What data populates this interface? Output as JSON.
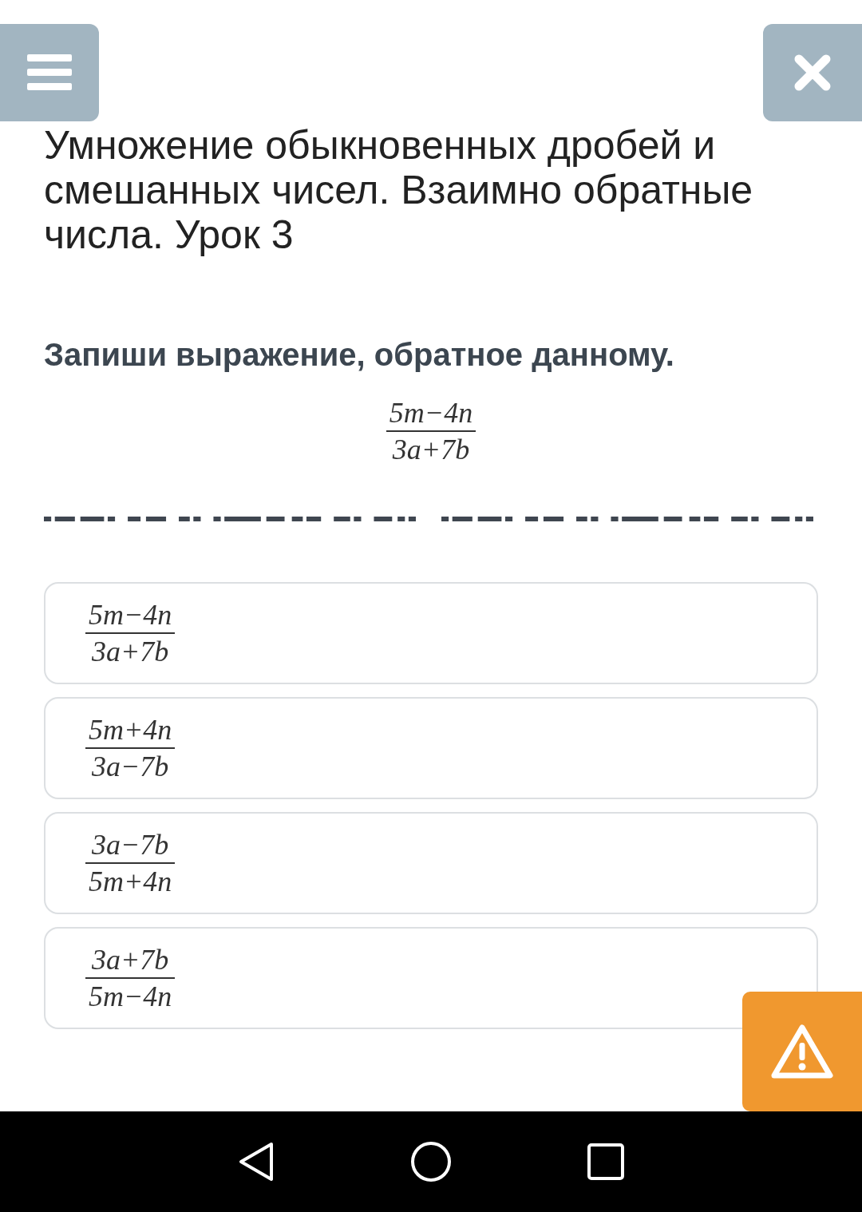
{
  "title": "Умножение обыкновенных дробей и смешанных чисел. Взаимно обратные числа. Урок 3",
  "question": "Запиши выражение, обратное данному.",
  "expression": {
    "numerator": "5m−4n",
    "denominator": "3a+7b"
  },
  "options": [
    {
      "numerator": "5m−4n",
      "denominator": "3a+7b"
    },
    {
      "numerator": "5m+4n",
      "denominator": "3a−7b"
    },
    {
      "numerator": "3a−7b",
      "denominator": "5m+4n"
    },
    {
      "numerator": "3a+7b",
      "denominator": "5m−4n"
    }
  ]
}
